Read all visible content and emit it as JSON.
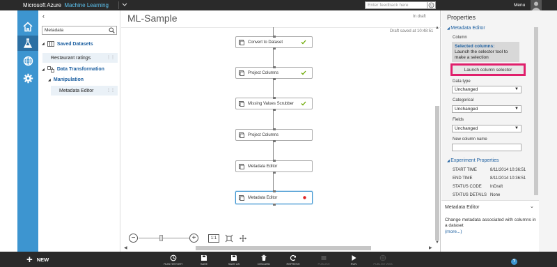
{
  "app": {
    "brand_primary": "Microsoft Azure",
    "brand_secondary": "Machine Learning",
    "feedback_placeholder": "Enter feedback here",
    "menu_label": "Menu"
  },
  "colors": {
    "accent": "#3d95d0",
    "topbar": "#2a2a2a",
    "highlight": "#e0206c",
    "ok_check": "#6aa800",
    "error_dot": "#e02020"
  },
  "rail": {
    "items": [
      {
        "icon": "home-icon"
      },
      {
        "icon": "flask-icon",
        "active": true
      },
      {
        "icon": "globe-icon"
      },
      {
        "icon": "gear-icon"
      }
    ]
  },
  "tree": {
    "search_value": "Metadata",
    "nodes": {
      "saved_datasets": "Saved Datasets",
      "restaurant_ratings": "Restaurant ratings",
      "data_transformation": "Data Transformation",
      "manipulation": "Manipulation",
      "metadata_editor": "Metadata Editor"
    }
  },
  "canvas": {
    "title": "ML-Sample",
    "status": "In draft",
    "saved_note": "Draft saved at 10:48:51",
    "nodes": [
      {
        "label": "Convert to Dataset",
        "state": "ok"
      },
      {
        "label": "Project Columns",
        "state": "ok"
      },
      {
        "label": "Missing Values Scrubber",
        "state": "ok"
      },
      {
        "label": "Project Columns",
        "state": "none"
      },
      {
        "label": "Metadata Editor",
        "state": "none"
      },
      {
        "label": "Metadata Editor",
        "state": "error",
        "selected": true
      }
    ],
    "zoom_fit_label": "1:1"
  },
  "properties": {
    "title": "Properties",
    "section_metadata": "Metadata Editor",
    "column_label": "Column",
    "selected_columns_label": "Selected columns:",
    "selector_hint": "Launch the selector tool to make a selection",
    "launch_button": "Launch column selector",
    "data_type_label": "Data type",
    "data_type_value": "Unchanged",
    "categorical_label": "Categorical",
    "categorical_value": "Unchanged",
    "fields_label": "Fields",
    "fields_value": "Unchanged",
    "new_column_label": "New column name",
    "new_column_value": "",
    "section_experiment": "Experiment Properties",
    "start_time_label": "START TIME",
    "start_time_value": "8/11/2014 10:36:51",
    "end_time_label": "END TIME",
    "end_time_value": "8/11/2014 10:36:51",
    "status_code_label": "STATUS CODE",
    "status_code_value": "InDraft",
    "status_details_label": "STATUS DETAILS",
    "status_details_value": "None"
  },
  "help": {
    "title": "Metadata Editor",
    "description": "Change metadata associated with columns in a dataset",
    "more": "(more...)"
  },
  "bottombar": {
    "new_label": "NEW",
    "commands": [
      {
        "label": "RUN HISTORY",
        "icon": "history-icon"
      },
      {
        "label": "SAVE",
        "icon": "save-icon"
      },
      {
        "label": "SAVE AS",
        "icon": "save-as-icon"
      },
      {
        "label": "DISCARD",
        "icon": "trash-icon"
      },
      {
        "label": "REFRESH",
        "icon": "refresh-icon"
      },
      {
        "label": "PUBLISH",
        "icon": "publish-icon",
        "disabled": true
      },
      {
        "label": "RUN",
        "icon": "run-icon"
      },
      {
        "label": "PUBLISH WEB",
        "icon": "publish-web-icon",
        "disabled": true
      }
    ]
  }
}
